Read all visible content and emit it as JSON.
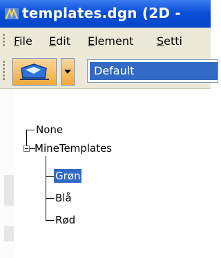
{
  "window": {
    "title": "templates.dgn (2D - "
  },
  "menu": {
    "items": [
      {
        "label": "File",
        "underline": "F",
        "rest": "ile"
      },
      {
        "label": "Edit",
        "underline": "E",
        "rest": "dit"
      },
      {
        "label": "Element",
        "underline": "E",
        "rest": "lement"
      },
      {
        "label": "Setti",
        "underline": "S",
        "rest": "etti"
      }
    ]
  },
  "toolbar": {
    "combo_value": "Default"
  },
  "tree": {
    "nodes": [
      {
        "label": "None",
        "level": 0
      },
      {
        "label": "MineTemplates",
        "level": 0,
        "expanded": true
      },
      {
        "label": "Grøn",
        "level": 1,
        "selected": true
      },
      {
        "label": "Blå",
        "level": 1
      },
      {
        "label": "Rød",
        "level": 1
      }
    ]
  },
  "colors": {
    "titlebar": "#0a4fd8",
    "selection": "#316ac5",
    "chrome": "#ece9d8"
  }
}
